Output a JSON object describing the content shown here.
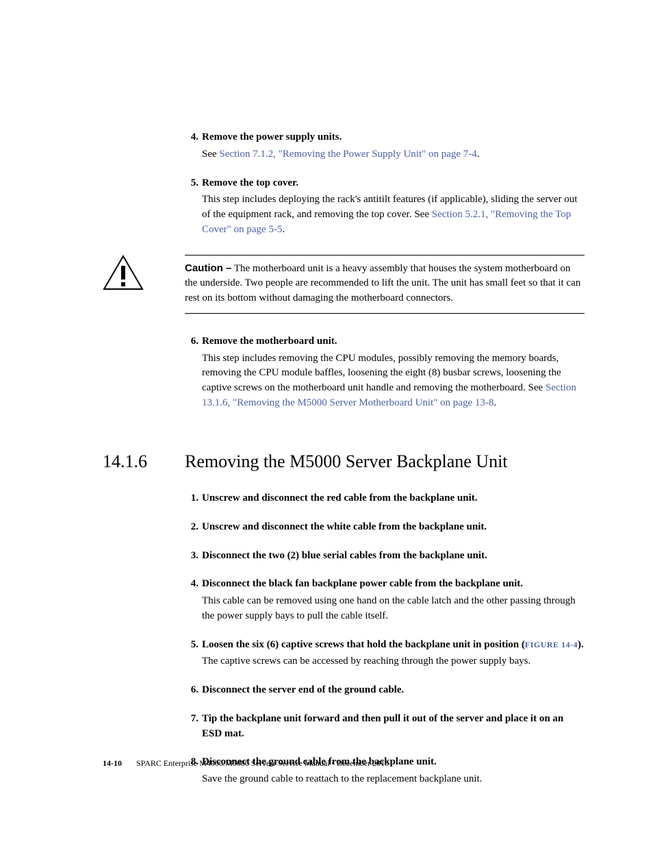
{
  "prev_steps": {
    "s4": {
      "num": "4.",
      "title": "Remove the power supply units.",
      "see_prefix": "See ",
      "link": "Section 7.1.2, \"Removing the Power Supply Unit\" on page 7-4",
      "see_suffix": "."
    },
    "s5": {
      "num": "5.",
      "title": "Remove the top cover.",
      "body_prefix": "This step includes deploying the rack's antitilt features (if applicable), sliding the server out of the equipment rack, and removing the top cover. See ",
      "link": "Section 5.2.1, \"Removing the Top Cover\" on page 5-5",
      "body_suffix": "."
    },
    "s6": {
      "num": "6.",
      "title": "Remove the motherboard unit.",
      "body_prefix": "This step includes removing the CPU modules, possibly removing the memory boards, removing the CPU module baffles, loosening the eight (8) busbar screws, loosening the captive screws on the motherboard unit handle and removing the motherboard. See ",
      "link": "Section 13.1.6, \"Removing the M5000 Server Motherboard Unit\" on page 13-8",
      "body_suffix": "."
    }
  },
  "caution": {
    "label": "Caution –",
    "text": " The motherboard unit is a heavy assembly that houses the system motherboard on the underside. Two people are recommended to lift the unit. The unit has small feet so that it can rest on its bottom without damaging the motherboard connectors."
  },
  "section": {
    "num": "14.1.6",
    "title": "Removing the M5000 Server Backplane Unit"
  },
  "steps": {
    "s1": {
      "num": "1.",
      "title": "Unscrew and disconnect the red cable from the backplane unit."
    },
    "s2": {
      "num": "2.",
      "title": "Unscrew and disconnect the white cable from the backplane unit."
    },
    "s3": {
      "num": "3.",
      "title": "Disconnect the two (2) blue serial cables from the backplane unit."
    },
    "s4": {
      "num": "4.",
      "title": "Disconnect the black fan backplane power cable from the backplane unit.",
      "body": "This cable can be removed using one hand on the cable latch and the other passing through the power supply bays to pull the cable itself."
    },
    "s5": {
      "num": "5.",
      "title_prefix": "Loosen the six (6) captive screws that hold the backplane unit in position (",
      "figref": "FIGURE 14-4",
      "title_suffix": ").",
      "body": "The captive screws can be accessed by reaching through the power supply bays."
    },
    "s6": {
      "num": "6.",
      "title": "Disconnect the server end of the ground cable."
    },
    "s7": {
      "num": "7.",
      "title": "Tip the backplane unit forward and then pull it out of the server and place it on an ESD mat."
    },
    "s8": {
      "num": "8.",
      "title": "Disconnect the ground cable from the backplane unit.",
      "body": "Save the ground cable to reattach to the replacement backplane unit."
    }
  },
  "footer": {
    "page": "14-10",
    "text": "SPARC Enterprise M4000/M5000 Servers Service Manual  •  December 2010"
  }
}
